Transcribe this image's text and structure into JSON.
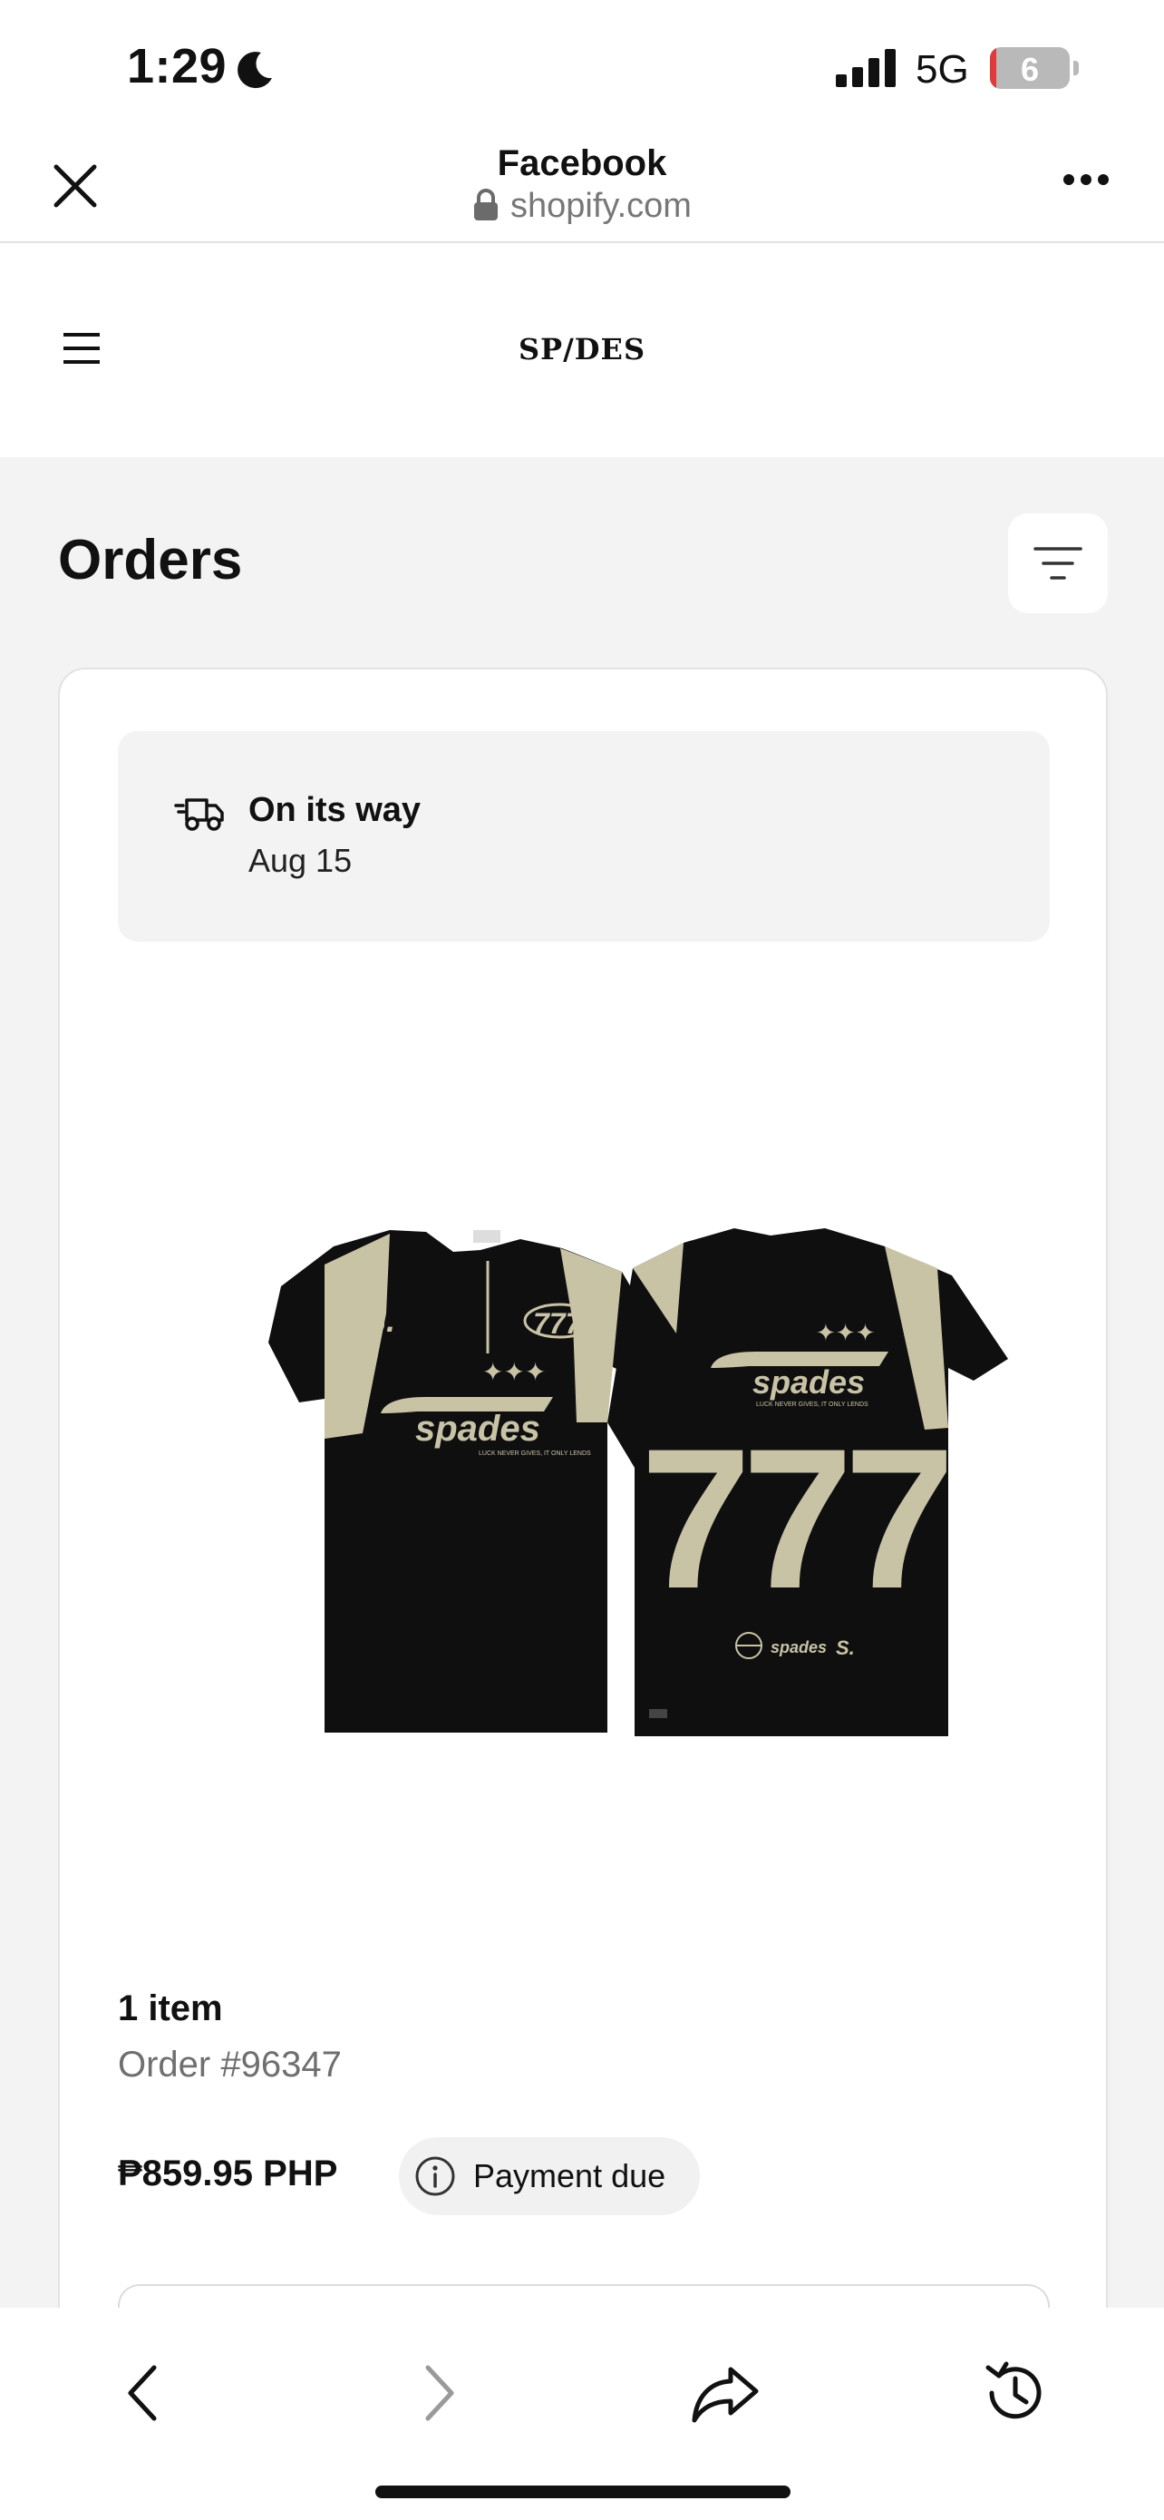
{
  "status_bar": {
    "time": "1:29",
    "network": "5G",
    "battery_level": "6",
    "battery_fraction": 0.06,
    "icons": [
      "moon-icon",
      "cellular-signal-icon",
      "battery-icon"
    ]
  },
  "browser": {
    "title": "Facebook",
    "url": "shopify.com",
    "icons": [
      "close-icon",
      "lock-icon",
      "more-icon"
    ]
  },
  "store": {
    "logo_text": "SP/DES",
    "icons": [
      "hamburger-menu-icon"
    ]
  },
  "orders_page": {
    "title": "Orders",
    "icons": [
      "filter-icon"
    ]
  },
  "order": {
    "status": "On its way",
    "status_date": "Aug 15",
    "item_count": "1 item",
    "order_number": "Order #96347",
    "price": "₱859.95 PHP",
    "payment_status": "Payment due",
    "product_print": {
      "front_chest_badge": "S.",
      "front_number_badge": "777",
      "brand": "spades",
      "tagline": "LUCK NEVER GIVES, IT ONLY LENDS",
      "back_number": "777"
    }
  },
  "toolbar": {
    "icons": [
      "back-arrow-icon",
      "forward-arrow-icon",
      "share-icon",
      "history-icon"
    ]
  },
  "colors": {
    "background_main": "#f3f3f3",
    "card": "#ffffff",
    "shirt_black": "#0f0f10",
    "shirt_accent": "#c9c3a6",
    "battery_low": "#e03a3a",
    "muted_text": "#6f6f6f"
  }
}
